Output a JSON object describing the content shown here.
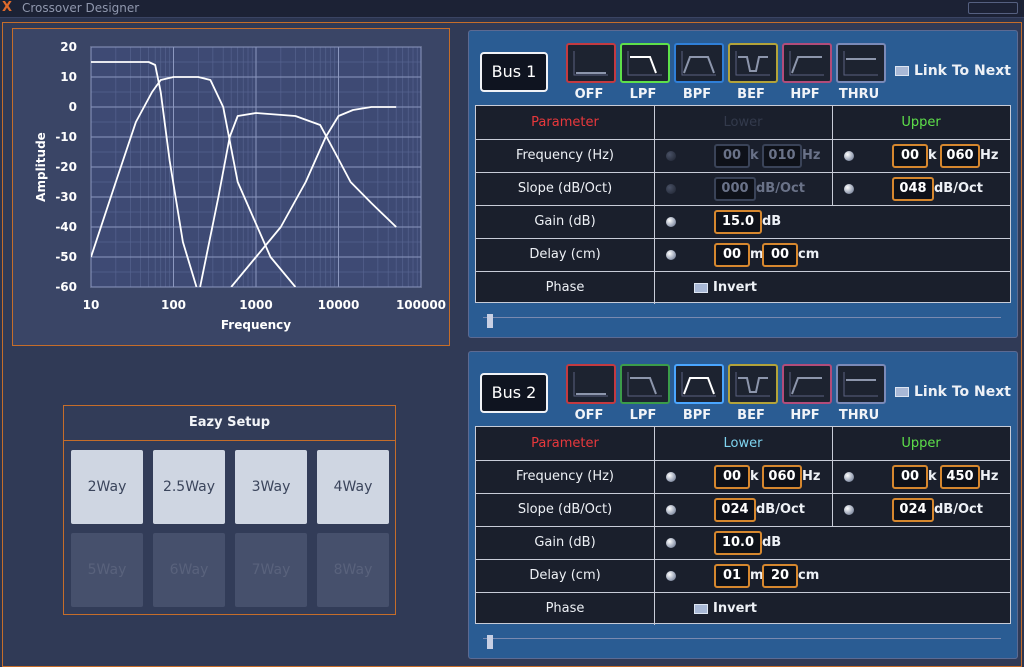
{
  "window": {
    "title": "Crossover Designer",
    "logo": "X"
  },
  "chart_data": {
    "type": "line",
    "xlabel": "Frequency",
    "ylabel": "Amplitude",
    "xscale": "log",
    "xlim": [
      10,
      100000
    ],
    "ylim": [
      -60,
      20
    ],
    "x_ticks": [
      "10",
      "100",
      "1000",
      "10000",
      "100000"
    ],
    "y_ticks": [
      "20",
      "10",
      "0",
      "-10",
      "-20",
      "-30",
      "-40",
      "-50",
      "-60"
    ],
    "grid": true,
    "series": [
      {
        "x": [
          10,
          50,
          60,
          70,
          90,
          130,
          190
        ],
        "y": [
          15,
          15,
          14,
          5,
          -18,
          -45,
          -60
        ]
      },
      {
        "x": [
          10,
          20,
          35,
          55,
          70,
          100,
          200,
          280,
          400,
          600,
          1500,
          3000
        ],
        "y": [
          -50,
          -25,
          -5,
          5,
          9,
          10,
          10,
          9,
          0,
          -25,
          -50,
          -60
        ]
      },
      {
        "x": [
          210,
          350,
          480,
          600,
          1000,
          3000,
          6000,
          9000,
          14000,
          25000,
          50000
        ],
        "y": [
          -60,
          -30,
          -10,
          -3,
          -2,
          -3,
          -6,
          -15,
          -25,
          -32,
          -40
        ]
      },
      {
        "x": [
          500,
          1000,
          2000,
          4000,
          7000,
          10000,
          15000,
          25000,
          50000
        ],
        "y": [
          -60,
          -50,
          -40,
          -25,
          -10,
          -3,
          -1,
          0,
          0
        ]
      }
    ]
  },
  "eazy_setup": {
    "title": "Eazy Setup",
    "buttons": [
      "2Way",
      "2.5Way",
      "3Way",
      "4Way"
    ],
    "ghost_buttons": [
      "5Way",
      "6Way",
      "7Way",
      "8Way"
    ]
  },
  "filter_types": [
    "OFF",
    "LPF",
    "BPF",
    "BEF",
    "HPF",
    "THRU"
  ],
  "link_label": "Link To Next",
  "table_headers": {
    "parameter": "Parameter",
    "lower": "Lower",
    "upper": "Upper"
  },
  "colors": {
    "parameter": "#e8383c",
    "lower": "#7fd4f0",
    "upper": "#5ee04a",
    "value_border": "#d6872e"
  },
  "row_labels": [
    "Frequency (Hz)",
    "Slope (dB/Oct)",
    "Gain (dB)",
    "Delay (cm)",
    "Phase"
  ],
  "units": {
    "k": "k",
    "hz": "Hz",
    "slope": "dB/Oct",
    "db": "dB",
    "m": "m",
    "cm": "cm"
  },
  "invert_label": "Invert",
  "buses": [
    {
      "label": "Bus 1",
      "selected_filter": "LPF",
      "lower_freq_k": "00",
      "lower_freq": "010",
      "upper_freq_k": "00",
      "upper_freq": "060",
      "lower_slope": "000",
      "upper_slope": "048",
      "gain": "15.0",
      "delay_m": "00",
      "delay_cm": "00"
    },
    {
      "label": "Bus 2",
      "selected_filter": "BPF",
      "lower_freq_k": "00",
      "lower_freq": "060",
      "upper_freq_k": "00",
      "upper_freq": "450",
      "lower_slope": "024",
      "upper_slope": "024",
      "gain": "10.0",
      "delay_m": "01",
      "delay_cm": "20"
    }
  ]
}
